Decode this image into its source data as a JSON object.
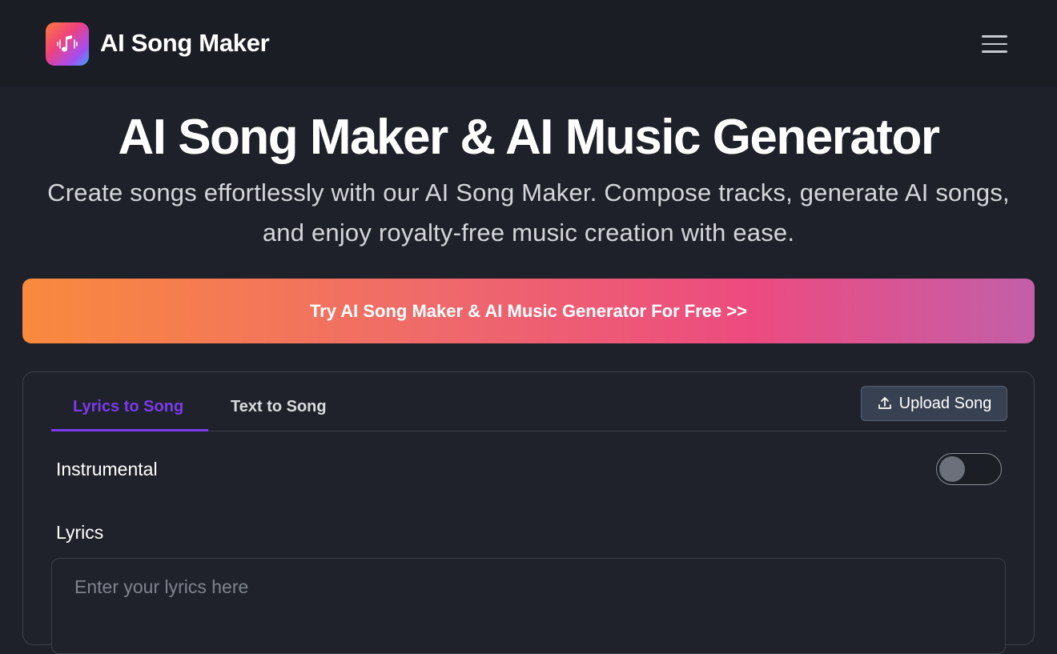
{
  "header": {
    "brand": "AI Song Maker",
    "logo_icon": "music-note-icon",
    "menu_icon": "hamburger-menu-icon"
  },
  "hero": {
    "title": "AI Song Maker & AI Music Generator",
    "subtitle_line1": "Create songs effortlessly with our AI Song Maker. Compose tracks, generate AI songs,",
    "subtitle_line2": "and enjoy royalty-free music creation with ease."
  },
  "cta": {
    "label": "Try AI Song Maker & AI Music Generator For Free >>"
  },
  "generator": {
    "tabs": [
      {
        "label": "Lyrics to Song",
        "active": true
      },
      {
        "label": "Text to Song",
        "active": false
      }
    ],
    "upload_label": "Upload Song",
    "upload_icon": "upload-icon",
    "instrumental_label": "Instrumental",
    "instrumental_on": false,
    "lyrics_label": "Lyrics",
    "lyrics_placeholder": "Enter your lyrics here"
  },
  "colors": {
    "background": "#1e2129",
    "accent": "#7c3aed",
    "cta_start": "#f98a3e",
    "cta_end": "#c35fa8"
  }
}
